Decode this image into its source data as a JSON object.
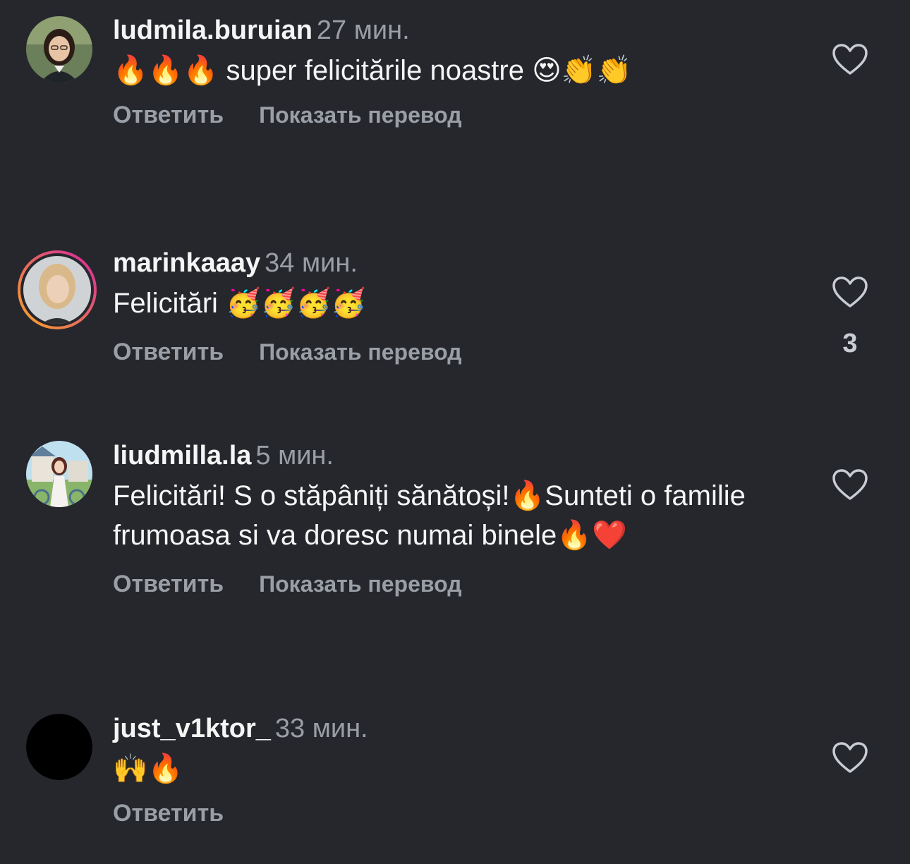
{
  "comments": [
    {
      "username": "ludmila.buruian",
      "time": "27 мин.",
      "text": "🔥🔥🔥 super felicitările noastre 😍👏👏",
      "reply": "Ответить",
      "translate": "Показать перевод",
      "like_count": ""
    },
    {
      "username": "marinkaaay",
      "time": "34 мин.",
      "text": "Felicitări 🥳🥳🥳🥳",
      "reply": "Ответить",
      "translate": "Показать перевод",
      "like_count": "3"
    },
    {
      "username": "liudmilla.la",
      "time": "5 мин.",
      "text": "Felicitări! S o stăpâniți sănătoși!🔥Sunteti o familie frumoasa si va doresc numai binele🔥❤️",
      "reply": "Ответить",
      "translate": "Показать перевод",
      "like_count": ""
    },
    {
      "username": "just_v1ktor_",
      "time": "33 мин.",
      "text": "🙌🔥",
      "reply": "Ответить",
      "translate": "",
      "like_count": ""
    }
  ],
  "icons": {
    "like": "heart-outline-icon",
    "avatar": "user-avatar"
  },
  "colors": {
    "background": "#25272c",
    "primary_text": "#f5f5f5",
    "secondary_text": "#9a9ea6",
    "story_ring_start": "#f9a826",
    "story_ring_end": "#d6249f"
  }
}
